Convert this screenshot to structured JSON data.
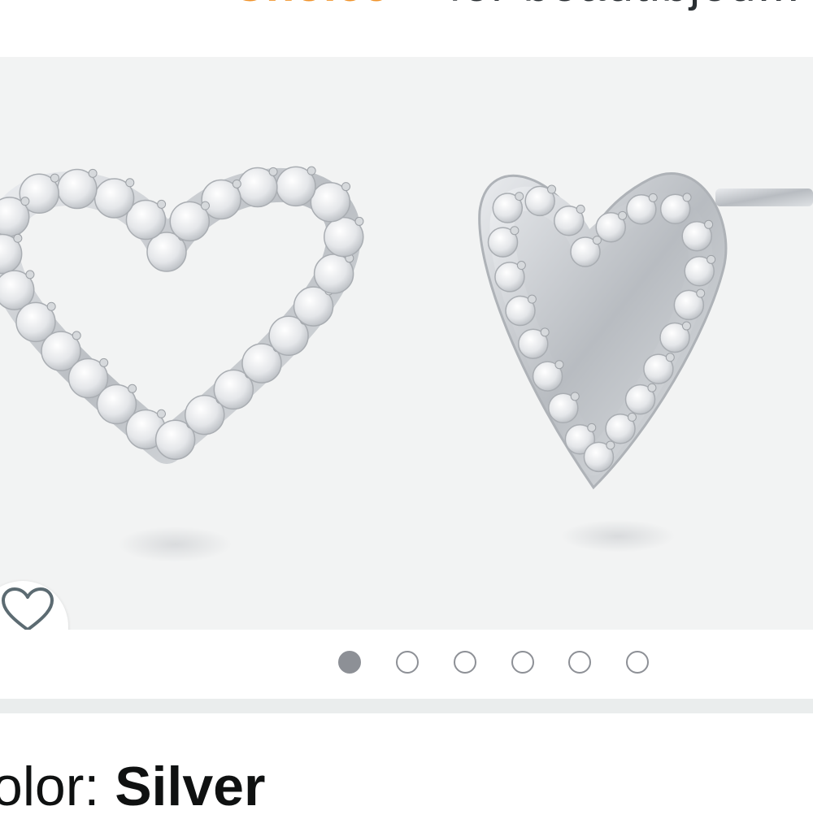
{
  "header": {
    "badge_text": "Choice",
    "title_fragment": "for  beautibjou..."
  },
  "product_image": {
    "description_icon": "heart-earrings-image",
    "background": "#f2f3f3",
    "metal_color": "#c9ccd0",
    "stone_color": "#eeeff1"
  },
  "wishlist": {
    "icon": "heart-outline-icon",
    "color": "#5c6b72"
  },
  "carousel": {
    "total": 6,
    "active_index": 0,
    "active_color": "#8d9096"
  },
  "variation": {
    "label": "olor: ",
    "value": "Silver"
  }
}
